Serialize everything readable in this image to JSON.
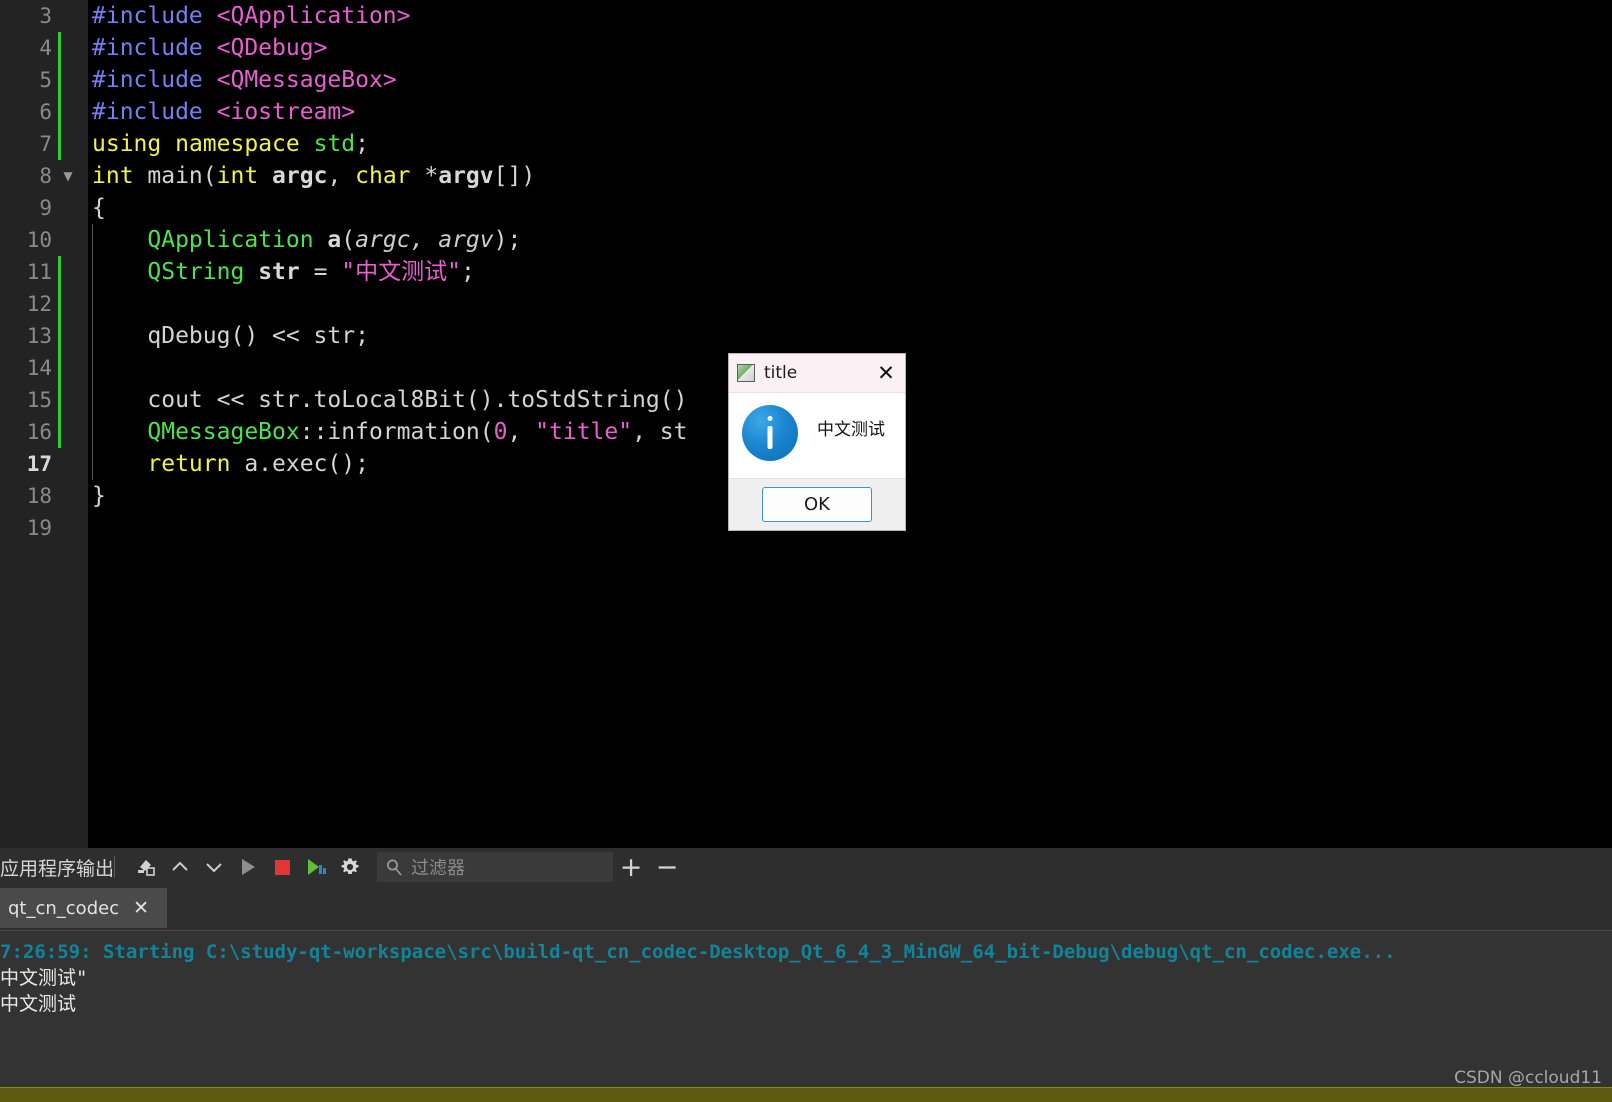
{
  "editor": {
    "lines": [
      {
        "no": "3",
        "fold": false,
        "changed": false,
        "indent_guide": false,
        "current": false
      },
      {
        "no": "4",
        "fold": false,
        "changed": true,
        "indent_guide": false,
        "current": false
      },
      {
        "no": "5",
        "fold": false,
        "changed": true,
        "indent_guide": false,
        "current": false
      },
      {
        "no": "6",
        "fold": false,
        "changed": true,
        "indent_guide": false,
        "current": false
      },
      {
        "no": "7",
        "fold": false,
        "changed": true,
        "indent_guide": false,
        "current": false
      },
      {
        "no": "8",
        "fold": true,
        "changed": false,
        "indent_guide": false,
        "current": false
      },
      {
        "no": "9",
        "fold": false,
        "changed": false,
        "indent_guide": false,
        "current": false
      },
      {
        "no": "10",
        "fold": false,
        "changed": false,
        "indent_guide": true,
        "current": false
      },
      {
        "no": "11",
        "fold": false,
        "changed": true,
        "indent_guide": true,
        "current": false
      },
      {
        "no": "12",
        "fold": false,
        "changed": true,
        "indent_guide": true,
        "current": false
      },
      {
        "no": "13",
        "fold": false,
        "changed": true,
        "indent_guide": true,
        "current": false
      },
      {
        "no": "14",
        "fold": false,
        "changed": true,
        "indent_guide": true,
        "current": false
      },
      {
        "no": "15",
        "fold": false,
        "changed": true,
        "indent_guide": true,
        "current": false
      },
      {
        "no": "16",
        "fold": false,
        "changed": true,
        "indent_guide": true,
        "current": false
      },
      {
        "no": "17",
        "fold": false,
        "changed": false,
        "indent_guide": true,
        "current": true
      },
      {
        "no": "18",
        "fold": false,
        "changed": false,
        "indent_guide": false,
        "current": false
      },
      {
        "no": "19",
        "fold": false,
        "changed": false,
        "indent_guide": false,
        "current": false
      }
    ],
    "code_text": [
      "#include <QApplication>",
      "#include <QDebug>",
      "#include <QMessageBox>",
      "#include <iostream>",
      "using namespace std;",
      "int main(int argc, char *argv[])",
      "{",
      "    QApplication a(argc, argv);",
      "    QString str = \"中文测试\";",
      "",
      "    qDebug() << str;",
      "",
      "    cout << str.toLocal8Bit().toStdString()",
      "    QMessageBox::information(0, \"title\", st",
      "    return a.exec();",
      "}",
      ""
    ],
    "colors": {
      "background": "#000000",
      "gutter": "#232323",
      "line_number": "#8a8a8a",
      "change_marker": "#2ecc2e",
      "preprocessor": "#7c7cf0",
      "include_header": "#e85fd0",
      "keyword": "#f2f24a",
      "class_name": "#4ee24e",
      "string": "#e85fd0",
      "number": "#e85fd0",
      "plain": "#d0d0d0"
    }
  },
  "dialog": {
    "title": "title",
    "message": "中文测试",
    "ok_label": "OK",
    "close_glyph": "✕",
    "icon": "information-icon",
    "titlebar_color": "#fbf1f4",
    "info_icon_color": "#1a84cf",
    "ok_border_color": "#3f8fd4"
  },
  "panel": {
    "title": "应用程序输出",
    "toolbar": {
      "clear_label": "clear-output",
      "prev_label": "previous-item",
      "next_label": "next-item",
      "run_label": "run",
      "stop_label": "stop",
      "rerun_label": "re-run",
      "settings_label": "settings",
      "add_label": "+",
      "remove_label": "−"
    },
    "filter": {
      "placeholder": "过滤器",
      "value": ""
    },
    "tabs": [
      {
        "label": "qt_cn_codec",
        "close_glyph": "✕",
        "active": true
      }
    ],
    "console": {
      "lines": [
        {
          "text": "7:26:59: Starting C:\\study-qt-workspace\\src\\build-qt_cn_codec-Desktop_Qt_6_4_3_MinGW_64_bit-Debug\\debug\\qt_cn_codec.exe...",
          "style": "teal"
        },
        {
          "text": "中文测试\"",
          "style": "white"
        },
        {
          "text": "中文测试",
          "style": "white"
        }
      ],
      "background": "#333333",
      "teal_color": "#11849a"
    }
  },
  "watermark": {
    "text": "CSDN @ccloud11"
  }
}
